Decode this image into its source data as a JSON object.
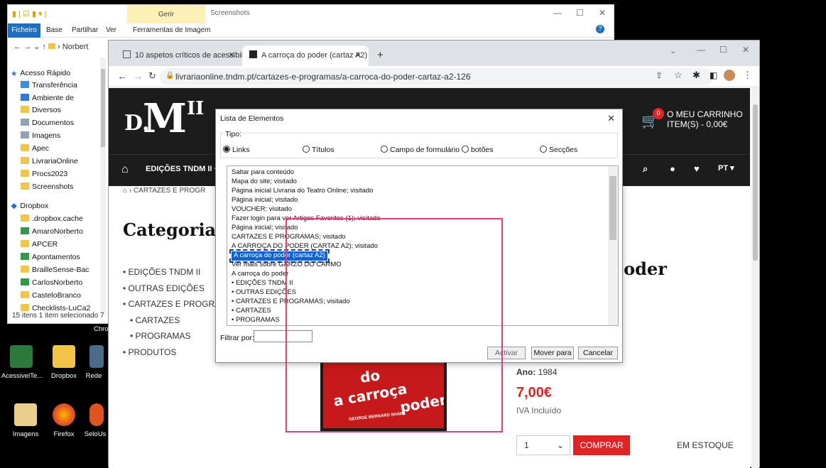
{
  "explorer": {
    "ribbon_group_label": "Gerir",
    "window_title": "Screenshots",
    "tabs": {
      "file": "Ficheiro",
      "home": "Base",
      "share": "Partilhar",
      "view": "Ver",
      "tools": "Ferramentas de Imagem"
    },
    "address_fragment": "Norbert",
    "nav_items": [
      "Acesso Rápido",
      "Transferência",
      "Ambiente de",
      "Diversos",
      "Documentos",
      "Imagens",
      "Apec",
      "LivrariaOnline",
      "Procs2023",
      "Screenshots",
      "Dropbox",
      ".dropbox.cache",
      "AmaroNorberto",
      "APCER",
      "Apontamentos",
      "BrailleSense-Bac",
      "CarlosNorberto",
      "CasteloBranco",
      "Checklists-LuCa2"
    ],
    "status": "15 itens    1 item selecionado 7",
    "taskbar_fragment": "Chro"
  },
  "desktop_icons": [
    "AcessivelTe...",
    "Dropbox",
    "Rede",
    "Imagens",
    "Firefox",
    "SeloUs"
  ],
  "chrome": {
    "tabs": [
      {
        "title": "10 aspetos críticos de acessibilid"
      },
      {
        "title": "A carroça do poder (cartaz A2)"
      }
    ],
    "url": "livrariaonline.tndm.pt/cartazes-e-programas/a-carroca-do-poder-cartaz-a2-126",
    "new_tab": "+"
  },
  "site": {
    "logo_d": "D.",
    "logo_m": "M",
    "logo_ii": "II",
    "cart_count": "0",
    "cart_line1": "O MEU CARRINHO",
    "cart_line2": "ITEM(S) - 0,00€",
    "nav_first": "EDIÇÕES TNDM II +",
    "lang": "PT",
    "breadcrumb": "CARTAZES E PROGR",
    "category_title": "Categorias",
    "categories": [
      {
        "label": "• EDIÇÕES TNDM II"
      },
      {
        "label": "• OUTRAS EDIÇÕES"
      },
      {
        "label": "• CARTAZES E PROGRA"
      },
      {
        "label": "• CARTAZES"
      },
      {
        "label": "• PROGRAMAS"
      },
      {
        "label": "• PRODUTOS"
      }
    ],
    "product_title_fragment": "o poder",
    "poster_text": {
      "a": "a",
      "carroca": "carroça",
      "do": "do",
      "poder": "poder",
      "credit": "GEORGE BERNARD SHAW"
    },
    "ano_label": "Ano:",
    "ano_value": "1984",
    "price": "7,00€",
    "iva": "IVA Incluído",
    "qty": "1",
    "buy": "COMPRAR",
    "stock": "EM ESTOQUE"
  },
  "dialog": {
    "title": "Lista de Elementos",
    "type_label": "Tipo:",
    "types": [
      {
        "label": "Links",
        "checked": true
      },
      {
        "label": "Títulos",
        "checked": false
      },
      {
        "label": "Campo de formulário",
        "checked": false
      },
      {
        "label": "botões",
        "checked": false
      },
      {
        "label": "Secções",
        "checked": false
      }
    ],
    "items": [
      "Saltar para conteúdo",
      "Mapa do site; visitado",
      "Página inicial Livraria do Teatro Online; visitado",
      "Página inicial; visitado",
      "VOUCHER; visitado",
      "Fazer login para ver Artigos Favoritos (1); visitado",
      "Página inicial; visitado",
      "CARTAZES E PROGRAMAS; visitado",
      "A CARROÇA DO PODER (CARTAZ A2); visitado",
      "A carroça do poder (cartaz A2)",
      "Ver mais sobre GARZO DO CARMO",
      "A carroça do poder",
      "• EDIÇÕES TNDM II",
      "• OUTRAS EDIÇÕES",
      "• CARTAZES E PROGRAMAS; visitado",
      "• CARTAZES",
      "• PROGRAMAS"
    ],
    "selected_index": 9,
    "filter_label": "Filtrar por:",
    "filter_value": "",
    "buttons": {
      "activate": "Activar",
      "move": "Mover para",
      "cancel": "Cancelar"
    }
  }
}
